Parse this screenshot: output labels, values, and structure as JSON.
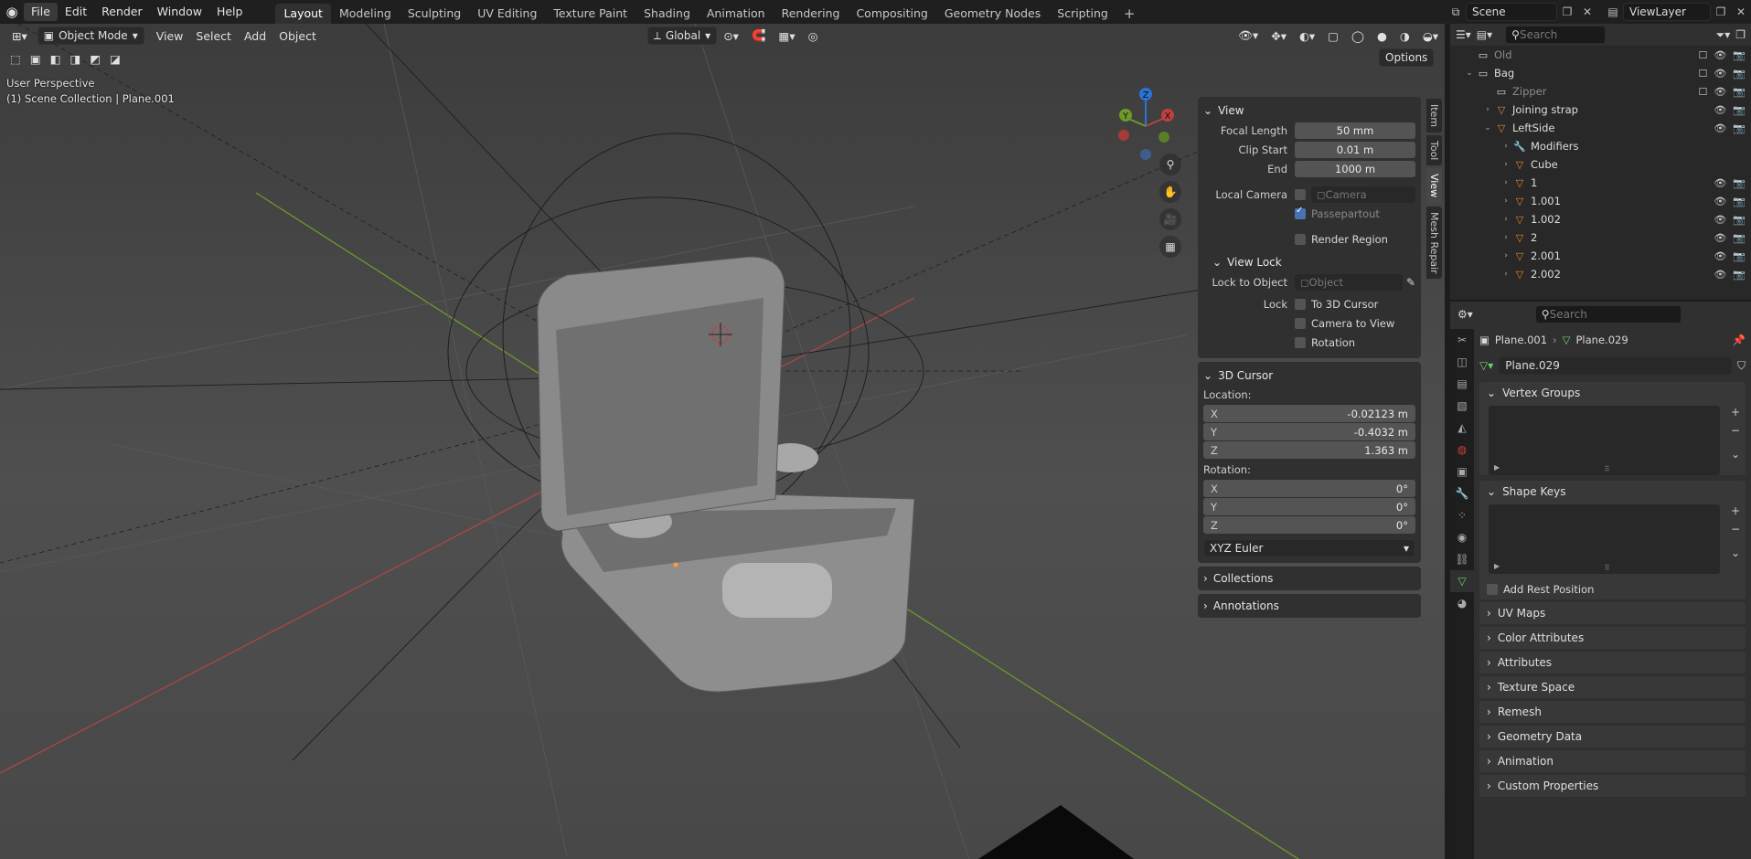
{
  "menu": {
    "items": [
      "File",
      "Edit",
      "Render",
      "Window",
      "Help"
    ],
    "workspaces": [
      "Layout",
      "Modeling",
      "Sculpting",
      "UV Editing",
      "Texture Paint",
      "Shading",
      "Animation",
      "Rendering",
      "Compositing",
      "Geometry Nodes",
      "Scripting"
    ],
    "active_workspace": "Layout"
  },
  "scene": {
    "name": "Scene",
    "view_layer": "ViewLayer"
  },
  "viewport": {
    "mode": "Object Mode",
    "menus": [
      "View",
      "Select",
      "Add",
      "Object"
    ],
    "transform_orientation": "Global",
    "options_label": "Options",
    "overlay_perspective": "User Perspective",
    "overlay_collection": "(1) Scene Collection | Plane.001",
    "gizmo_axes": {
      "x": "X",
      "y": "Y",
      "z": "Z"
    },
    "colors": {
      "x_axis": "#c0403f",
      "y_axis": "#6d9a2b",
      "z_axis": "#2b73d4"
    }
  },
  "npanel": {
    "tabs": [
      "Item",
      "Tool",
      "View",
      "Mesh Repair"
    ],
    "active_tab": "View",
    "view": {
      "title": "View",
      "focal_length_label": "Focal Length",
      "focal_length": "50 mm",
      "clip_start_label": "Clip Start",
      "clip_start": "0.01 m",
      "end_label": "End",
      "end": "1000 m",
      "local_camera_label": "Local Camera",
      "local_camera_value": "Camera",
      "passepartout_label": "Passepartout",
      "render_region_label": "Render Region"
    },
    "view_lock": {
      "title": "View Lock",
      "lock_to_object_label": "Lock to Object",
      "lock_to_object_placeholder": "Object",
      "lock_label": "Lock",
      "to_3d_cursor": "To 3D Cursor",
      "camera_to_view": "Camera to View",
      "rotation": "Rotation"
    },
    "cursor": {
      "title": "3D Cursor",
      "location_label": "Location:",
      "loc_x": "-0.02123 m",
      "loc_y": "-0.4032 m",
      "loc_z": "1.363 m",
      "rotation_label": "Rotation:",
      "rot_x": "0°",
      "rot_y": "0°",
      "rot_z": "0°",
      "mode": "XYZ Euler"
    },
    "collections_title": "Collections",
    "annotations_title": "Annotations"
  },
  "outliner": {
    "search_placeholder": "Search",
    "rows": [
      {
        "name": "Old",
        "indent": 0,
        "icon": "collection",
        "dim": true
      },
      {
        "name": "Bag",
        "indent": 0,
        "icon": "collection",
        "open": true
      },
      {
        "name": "Zipper",
        "indent": 1,
        "icon": "collection",
        "dim": true
      },
      {
        "name": "Joining strap",
        "indent": 1,
        "icon": "mesh"
      },
      {
        "name": "LeftSide",
        "indent": 1,
        "icon": "mesh",
        "open": true
      },
      {
        "name": "Modifiers",
        "indent": 2,
        "icon": "wrench"
      },
      {
        "name": "Cube",
        "indent": 2,
        "icon": "mesh"
      },
      {
        "name": "1",
        "indent": 2,
        "icon": "mesh"
      },
      {
        "name": "1.001",
        "indent": 2,
        "icon": "mesh"
      },
      {
        "name": "1.002",
        "indent": 2,
        "icon": "mesh"
      },
      {
        "name": "2",
        "indent": 2,
        "icon": "mesh"
      },
      {
        "name": "2.001",
        "indent": 2,
        "icon": "mesh"
      },
      {
        "name": "2.002",
        "indent": 2,
        "icon": "mesh"
      }
    ]
  },
  "properties": {
    "search_placeholder": "Search",
    "breadcrumb_object": "Plane.001",
    "breadcrumb_data": "Plane.029",
    "data_name": "Plane.029",
    "vertex_groups": "Vertex Groups",
    "shape_keys": "Shape Keys",
    "add_rest_position": "Add Rest Position",
    "sections": [
      "UV Maps",
      "Color Attributes",
      "Attributes",
      "Texture Space",
      "Remesh",
      "Geometry Data",
      "Animation",
      "Custom Properties"
    ]
  }
}
